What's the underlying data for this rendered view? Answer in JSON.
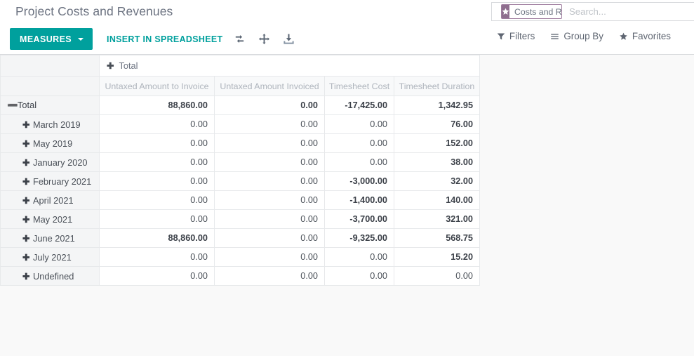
{
  "control_panel": {
    "title": "Project Costs and Revenues",
    "measures_label": "MEASURES",
    "insert_spreadsheet_label": "INSERT IN SPREADSHEET",
    "icons": [
      {
        "name": "flip-axis-icon",
        "title": "Flip axis"
      },
      {
        "name": "expand-all-icon",
        "title": "Expand all"
      },
      {
        "name": "download-xlsx-icon",
        "title": "Download xlsx"
      }
    ],
    "accent_color": "#00A09D"
  },
  "search": {
    "facet": {
      "badge_icon": "star-icon",
      "label": "Costs and Revenues",
      "remove_label": "✖",
      "badge_color": "#8E6E8E",
      "border_color": "#9E7C9E"
    },
    "placeholder": "Search...",
    "value": ""
  },
  "search_menus": [
    {
      "label": "Filters",
      "icon": "filter-funnel-icon"
    },
    {
      "label": "Group By",
      "icon": "group-by-lines-icon"
    },
    {
      "label": "Favorites",
      "icon": "star-icon"
    }
  ],
  "pivot": {
    "col_group_header": {
      "toggle": "✚",
      "label": "Total"
    },
    "measures": [
      "Untaxed Amount to Invoice",
      "Untaxed Amount Invoiced",
      "Timesheet Cost",
      "Timesheet Duration"
    ],
    "rows": [
      {
        "toggle": "➖",
        "label": "Total",
        "total": true,
        "indent": false,
        "values": [
          "88,860.00",
          "0.00",
          "-17,425.00",
          "1,342.95"
        ]
      },
      {
        "toggle": "✚",
        "label": "March 2019",
        "total": false,
        "indent": true,
        "values": [
          "0.00",
          "0.00",
          "0.00",
          "76.00"
        ]
      },
      {
        "toggle": "✚",
        "label": "May 2019",
        "total": false,
        "indent": true,
        "values": [
          "0.00",
          "0.00",
          "0.00",
          "152.00"
        ]
      },
      {
        "toggle": "✚",
        "label": "January 2020",
        "total": false,
        "indent": true,
        "values": [
          "0.00",
          "0.00",
          "0.00",
          "38.00"
        ]
      },
      {
        "toggle": "✚",
        "label": "February 2021",
        "total": false,
        "indent": true,
        "values": [
          "0.00",
          "0.00",
          "-3,000.00",
          "32.00"
        ]
      },
      {
        "toggle": "✚",
        "label": "April 2021",
        "total": false,
        "indent": true,
        "values": [
          "0.00",
          "0.00",
          "-1,400.00",
          "140.00"
        ]
      },
      {
        "toggle": "✚",
        "label": "May 2021",
        "total": false,
        "indent": true,
        "values": [
          "0.00",
          "0.00",
          "-3,700.00",
          "321.00"
        ]
      },
      {
        "toggle": "✚",
        "label": "June 2021",
        "total": false,
        "indent": true,
        "values": [
          "88,860.00",
          "0.00",
          "-9,325.00",
          "568.75"
        ]
      },
      {
        "toggle": "✚",
        "label": "July 2021",
        "total": false,
        "indent": true,
        "values": [
          "0.00",
          "0.00",
          "0.00",
          "15.20"
        ]
      },
      {
        "toggle": "✚",
        "label": "Undefined",
        "total": false,
        "indent": true,
        "values": [
          "0.00",
          "0.00",
          "0.00",
          "0.00"
        ]
      }
    ]
  },
  "chart_data": {
    "type": "table",
    "title": "Project Costs and Revenues",
    "categories": [
      "Total",
      "March 2019",
      "May 2019",
      "January 2020",
      "February 2021",
      "April 2021",
      "May 2021",
      "June 2021",
      "July 2021",
      "Undefined"
    ],
    "series": [
      {
        "name": "Untaxed Amount to Invoice",
        "values": [
          88860.0,
          0.0,
          0.0,
          0.0,
          0.0,
          0.0,
          0.0,
          88860.0,
          0.0,
          0.0
        ]
      },
      {
        "name": "Untaxed Amount Invoiced",
        "values": [
          0.0,
          0.0,
          0.0,
          0.0,
          0.0,
          0.0,
          0.0,
          0.0,
          0.0,
          0.0
        ]
      },
      {
        "name": "Timesheet Cost",
        "values": [
          -17425.0,
          0.0,
          0.0,
          0.0,
          -3000.0,
          -1400.0,
          -3700.0,
          -9325.0,
          0.0,
          0.0
        ]
      },
      {
        "name": "Timesheet Duration",
        "values": [
          1342.95,
          76.0,
          152.0,
          38.0,
          32.0,
          140.0,
          321.0,
          568.75,
          15.2,
          0.0
        ]
      }
    ],
    "xlabel": "",
    "ylabel": "",
    "grid": true,
    "legend": "none"
  }
}
